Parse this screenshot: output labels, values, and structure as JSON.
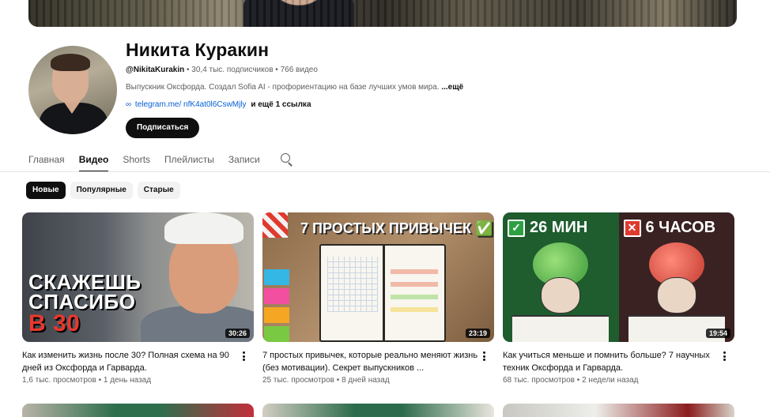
{
  "channel": {
    "name": "Никита Куракин",
    "handle": "@NikitaKurakin",
    "subscribers": "30,4 тыс. подписчиков",
    "videos_count": "766 видео",
    "separator": "•",
    "description": "Выпускник Оксфорда. Создал Sofia AI - профориентацию на базе лучших умов мира.",
    "description_more": "...ещё",
    "link_text": "telegram.me/ nfK4at0l6CswMjly",
    "link_extra": "и ещё 1 ссылка",
    "subscribe_label": "Подписаться"
  },
  "tabs": [
    {
      "label": "Главная",
      "active": false
    },
    {
      "label": "Видео",
      "active": true
    },
    {
      "label": "Shorts",
      "active": false
    },
    {
      "label": "Плейлисты",
      "active": false
    },
    {
      "label": "Записи",
      "active": false
    }
  ],
  "filters": [
    {
      "label": "Новые",
      "active": true
    },
    {
      "label": "Популярные",
      "active": false
    },
    {
      "label": "Старые",
      "active": false
    }
  ],
  "videos": [
    {
      "title": "Как изменить жизнь после 30? Полная схема на 90 дней из Оксфорда и Гарварда.",
      "views": "1,6 тыс. просмотров",
      "age": "1 день назад",
      "duration": "30:26",
      "thumb_text": [
        "СКАЖЕШЬ",
        "СПАСИБО",
        "В 30"
      ]
    },
    {
      "title": "7 простых привычек, которые реально меняют жизнь (без мотивации). Секрет выпускников ...",
      "views": "25 тыс. просмотров",
      "age": "8 дней назад",
      "duration": "23:19",
      "thumb_text": [
        "7 ПРОСТЫХ ПРИВЫЧЕК ✅"
      ]
    },
    {
      "title": "Как учиться меньше и помнить больше? 7 научных техник Оксфорда и Гарварда.",
      "views": "68 тыс. просмотров",
      "age": "2 недели назад",
      "duration": "19:54",
      "thumb_text": [
        "26 МИН",
        "6 ЧАСОВ"
      ]
    }
  ],
  "colors": {
    "text_primary": "#0f0f0f",
    "text_secondary": "#606060",
    "link": "#065fd4",
    "chip_bg": "#f2f2f2"
  }
}
